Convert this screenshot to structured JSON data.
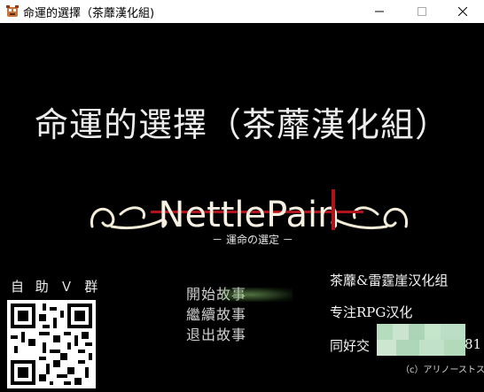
{
  "window": {
    "title": "命運的選擇（茶蘼漢化組)",
    "icon": "game-app-icon",
    "controls": [
      "minimize-icon",
      "maximize-icon",
      "close-icon"
    ]
  },
  "game": {
    "title": "命運的選擇（茶蘼漢化組）",
    "logo_text": "NettlePain",
    "logo_subtitle": "－ 運命の選定 －",
    "logo_accent": "#b0141a",
    "group_label": "自 助 Ｖ 群",
    "menu": [
      {
        "label": "開始故事",
        "selected": true
      },
      {
        "label": "繼續故事",
        "selected": false
      },
      {
        "label": "退出故事",
        "selected": false
      }
    ],
    "credits": {
      "line1": "茶蘼&雷霆崖汉化组",
      "line2": "专注RPG汉化",
      "line3_visible": "同好交",
      "line3_tail": "81"
    },
    "copyright": "（c）アリノーストス"
  }
}
